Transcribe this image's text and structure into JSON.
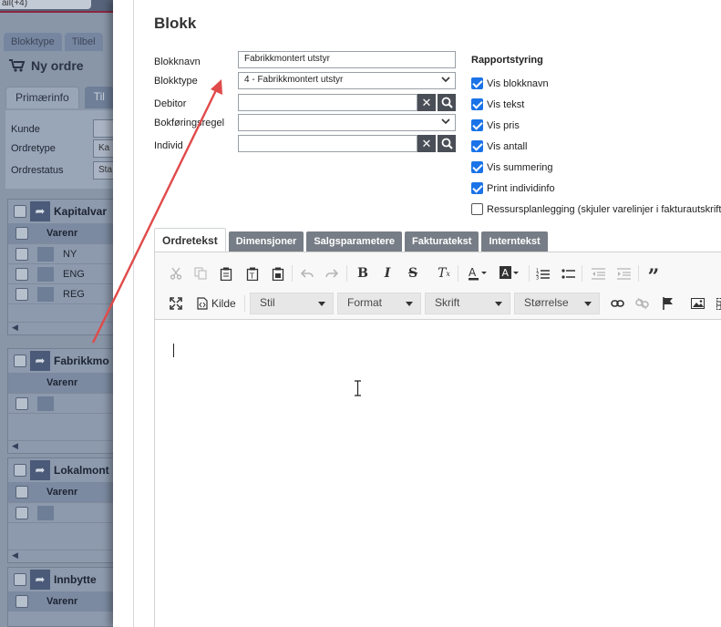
{
  "background": {
    "top_select_text": "ail(+4)",
    "tabs": [
      "Blokktype",
      "Tilbel"
    ],
    "page_title": "Ny ordre",
    "subtabs": [
      "Primærinfo",
      "Til"
    ],
    "form": {
      "kunde_label": "Kunde",
      "ordretype_label": "Ordretype",
      "ordretype_value": "Ka",
      "ordrestatus_label": "Ordrestatus",
      "ordrestatus_value": "Sta"
    },
    "sections": [
      {
        "name": "Kapitalvar",
        "col": "Varenr",
        "rows": [
          "NY",
          "ENG",
          "REG"
        ]
      },
      {
        "name": "Fabrikkmo",
        "col": "Varenr",
        "rows": [
          ""
        ]
      },
      {
        "name": "Lokalmont",
        "col": "Varenr",
        "rows": [
          ""
        ]
      },
      {
        "name": "Innbytte",
        "col": "Varenr",
        "rows": [
          ""
        ]
      }
    ]
  },
  "modal": {
    "title": "Blokk",
    "fields": {
      "blokknavn_label": "Blokknavn",
      "blokknavn_value": "Fabrikkmontert utstyr",
      "blokktype_label": "Blokktype",
      "blokktype_value": "4 - Fabrikkmontert utstyr",
      "debitor_label": "Debitor",
      "debitor_value": "",
      "bokforingsregel_label": "Bokføringsregel",
      "bokforingsregel_value": "",
      "individ_label": "Individ",
      "individ_value": ""
    },
    "rapportstyring": {
      "title": "Rapportstyring",
      "options": [
        {
          "label": "Vis blokknavn",
          "checked": true
        },
        {
          "label": "Vis tekst",
          "checked": true
        },
        {
          "label": "Vis pris",
          "checked": true
        },
        {
          "label": "Vis antall",
          "checked": true
        },
        {
          "label": "Vis summering",
          "checked": true
        },
        {
          "label": "Print individinfo",
          "checked": true
        },
        {
          "label": "Ressursplanlegging (skjuler varelinjer i fakturautskrift)",
          "checked": false
        }
      ]
    },
    "tabs": [
      "Ordretekst",
      "Dimensjoner",
      "Salgsparametere",
      "Fakturatekst",
      "Interntekst"
    ],
    "active_tab": "Ordretekst",
    "editor": {
      "kilde_label": "Kilde",
      "combos": [
        "Stil",
        "Format",
        "Skrift",
        "Størrelse"
      ],
      "content": ""
    }
  },
  "colors": {
    "checkbox_accent": "#1a73e8",
    "tab_inactive": "#777d86",
    "annotation_arrow": "#e04a4a",
    "overlay": "#5e6b7b"
  }
}
